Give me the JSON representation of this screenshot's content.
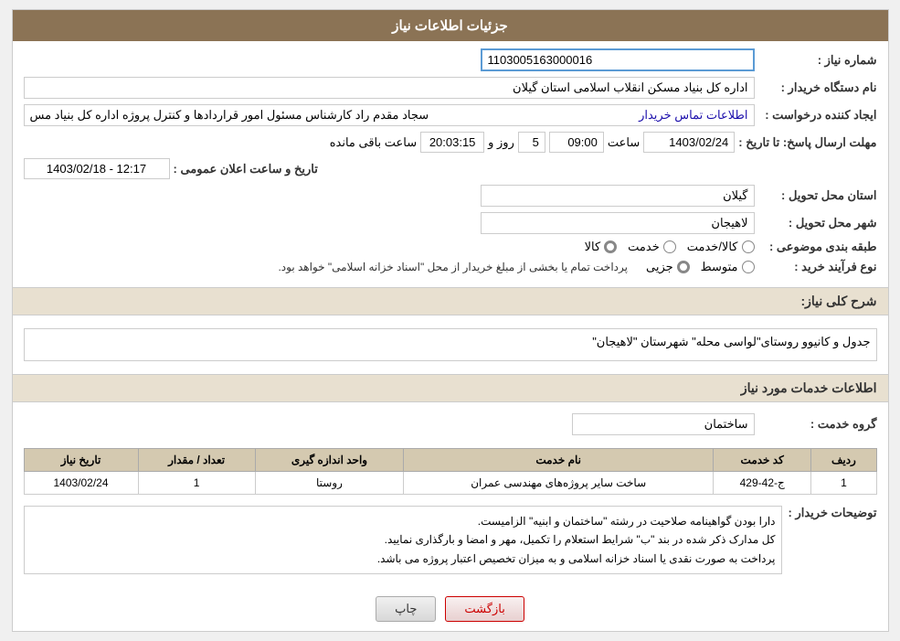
{
  "header": {
    "title": "جزئیات اطلاعات نیاز"
  },
  "fields": {
    "need_number_label": "شماره نیاز :",
    "need_number_value": "1103005163000016",
    "org_name_label": "نام دستگاه خریدار :",
    "org_name_value": "اداره کل بنیاد مسکن انقلاب اسلامی استان گیلان",
    "creator_label": "ایجاد کننده درخواست :",
    "creator_value": "سجاد  مقدم راد کارشناس مسئول امور قراردادها و کنترل پروژه اداره کل بنیاد مس",
    "creator_link": "اطلاعات تماس خریدار",
    "deadline_label": "مهلت ارسال پاسخ: تا تاریخ :",
    "deadline_date": "1403/02/24",
    "deadline_time": "09:00",
    "deadline_days": "5",
    "deadline_days_label": "روز و",
    "deadline_remaining": "20:03:15",
    "deadline_remaining_label": "ساعت باقی مانده",
    "province_label": "استان محل تحویل :",
    "province_value": "گیلان",
    "city_label": "شهر محل تحویل :",
    "city_value": "لاهیجان",
    "category_label": "طبقه بندی موضوعی :",
    "category_options": [
      "کالا",
      "خدمت",
      "کالا/خدمت"
    ],
    "category_selected": "کالا",
    "process_label": "نوع فرآیند خرید :",
    "process_options": [
      "جزیی",
      "متوسط"
    ],
    "process_note": "پرداخت تمام یا بخشی از مبلغ خریدار از محل \"اسناد خزانه اسلامی\" خواهد بود.",
    "announcement_label": "تاریخ و ساعت اعلان عمومی :",
    "announcement_value": "1403/02/18 - 12:17"
  },
  "description": {
    "section_title": "شرح کلی نیاز:",
    "value": "جدول و کانیوو روستای\"لواسی محله\" شهرستان \"لاهیجان\""
  },
  "services_section": {
    "title": "اطلاعات خدمات مورد نیاز",
    "group_label": "گروه خدمت :",
    "group_value": "ساختمان",
    "table_headers": [
      "ردیف",
      "کد خدمت",
      "نام خدمت",
      "واحد اندازه گیری",
      "تعداد / مقدار",
      "تاریخ نیاز"
    ],
    "table_rows": [
      {
        "row_num": "1",
        "service_code": "ج-42-429",
        "service_name": "ساخت سایر پروژه‌های مهندسی عمران",
        "unit": "روستا",
        "quantity": "1",
        "date": "1403/02/24"
      }
    ]
  },
  "buyer_notes": {
    "label": "توضیحات خریدار :",
    "lines": [
      "دارا بودن گواهینامه صلاحیت در رشته \"ساختمان و ابنیه\" الزامیست.",
      "کل مدارک ذکر شده در بند \"ب\" شرایط استعلام را تکمیل، مهر و امضا و بارگذاری نمایید.",
      "پرداخت به صورت نقدی یا اسناد خزانه اسلامی و به میزان تخصیص اعتبار پروژه می باشد."
    ]
  },
  "buttons": {
    "print_label": "چاپ",
    "back_label": "بازگشت"
  }
}
